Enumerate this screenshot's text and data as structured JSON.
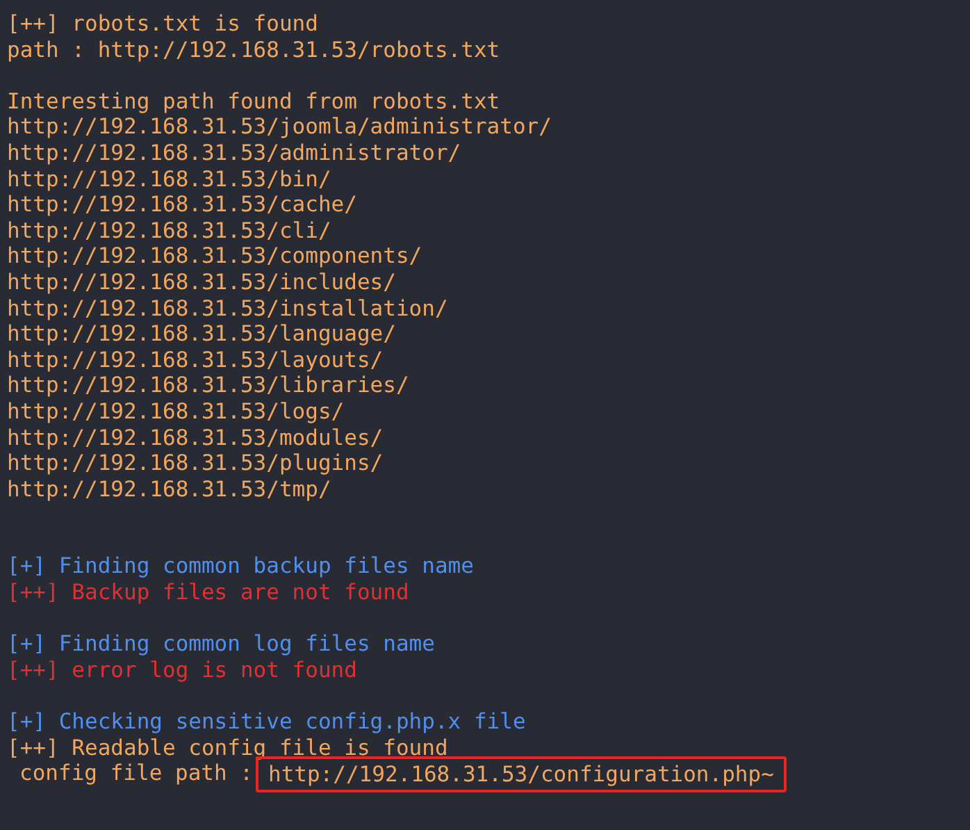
{
  "lines": [
    {
      "kind": "orange",
      "text": "[++] robots.txt is found"
    },
    {
      "kind": "orange",
      "text": "path : http://192.168.31.53/robots.txt"
    },
    {
      "kind": "blank"
    },
    {
      "kind": "orange",
      "text": "Interesting path found from robots.txt"
    },
    {
      "kind": "orange",
      "text": "http://192.168.31.53/joomla/administrator/"
    },
    {
      "kind": "orange",
      "text": "http://192.168.31.53/administrator/"
    },
    {
      "kind": "orange",
      "text": "http://192.168.31.53/bin/"
    },
    {
      "kind": "orange",
      "text": "http://192.168.31.53/cache/"
    },
    {
      "kind": "orange",
      "text": "http://192.168.31.53/cli/"
    },
    {
      "kind": "orange",
      "text": "http://192.168.31.53/components/"
    },
    {
      "kind": "orange",
      "text": "http://192.168.31.53/includes/"
    },
    {
      "kind": "orange",
      "text": "http://192.168.31.53/installation/"
    },
    {
      "kind": "orange",
      "text": "http://192.168.31.53/language/"
    },
    {
      "kind": "orange",
      "text": "http://192.168.31.53/layouts/"
    },
    {
      "kind": "orange",
      "text": "http://192.168.31.53/libraries/"
    },
    {
      "kind": "orange",
      "text": "http://192.168.31.53/logs/"
    },
    {
      "kind": "orange",
      "text": "http://192.168.31.53/modules/"
    },
    {
      "kind": "orange",
      "text": "http://192.168.31.53/plugins/"
    },
    {
      "kind": "orange",
      "text": "http://192.168.31.53/tmp/"
    },
    {
      "kind": "blank"
    },
    {
      "kind": "blank"
    },
    {
      "kind": "blue",
      "text": "[+] Finding common backup files name"
    },
    {
      "kind": "red",
      "text": "[++] Backup files are not found"
    },
    {
      "kind": "blank"
    },
    {
      "kind": "blue",
      "text": "[+] Finding common log files name"
    },
    {
      "kind": "red",
      "text": "[++] error log is not found"
    },
    {
      "kind": "blank"
    },
    {
      "kind": "blue",
      "text": "[+] Checking sensitive config.php.x file"
    },
    {
      "kind": "orange",
      "text": "[++] Readable config file is found"
    },
    {
      "kind": "boxed",
      "text": "config file path :",
      "highlight": "http://192.168.31.53/configuration.php~"
    }
  ]
}
